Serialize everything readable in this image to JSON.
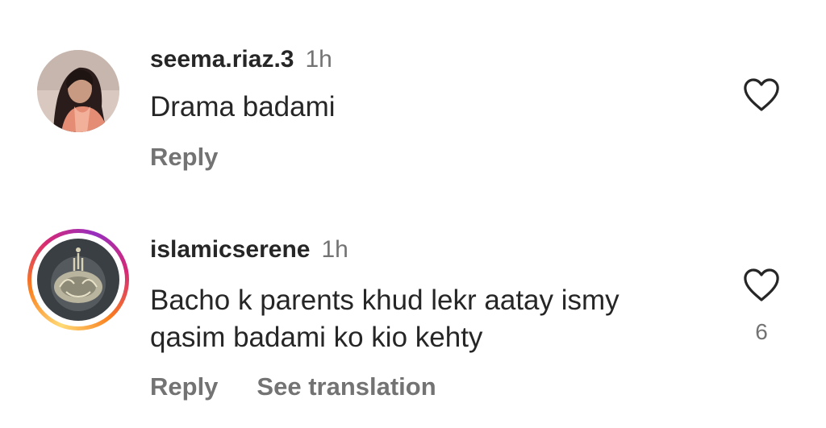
{
  "comments": [
    {
      "username": "seema.riaz.3",
      "time": "1h",
      "text": "Drama badami",
      "reply_label": "Reply",
      "like_count": "",
      "avatar_icon": "profile-photo-woman",
      "has_story_ring": false
    },
    {
      "username": "islamicserene",
      "time": "1h",
      "text": "Bacho k parents khud lekr aatay ismy qasim badami ko kio kehty",
      "reply_label": "Reply",
      "see_translation_label": "See translation",
      "like_count": "6",
      "avatar_icon": "islamic-calligraphy-emblem",
      "has_story_ring": true
    }
  ],
  "colors": {
    "text_primary": "#262626",
    "text_secondary": "#737373",
    "heart_outline": "#262626",
    "story_ring": [
      "#feda75",
      "#fa7e1e",
      "#d62976",
      "#962fbf"
    ]
  }
}
